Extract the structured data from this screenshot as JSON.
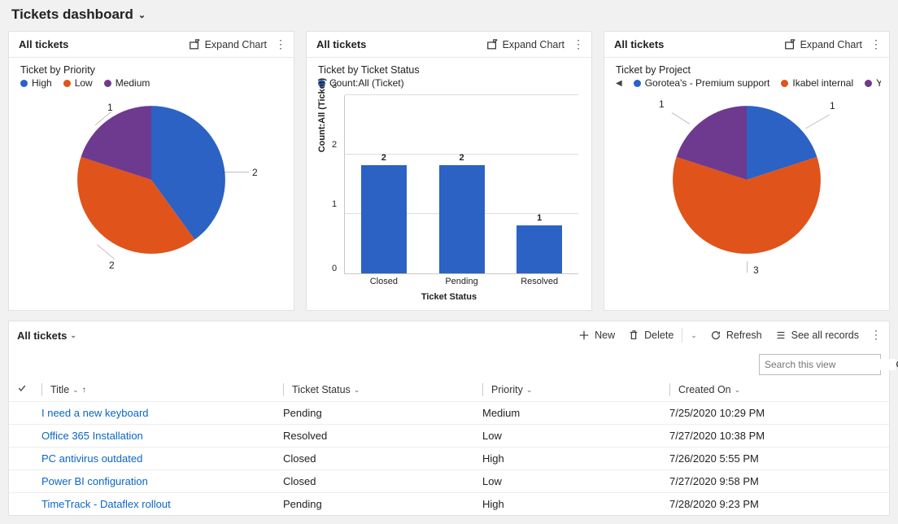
{
  "header": {
    "title": "Tickets dashboard"
  },
  "cards": {
    "priority": {
      "panel_title": "All tickets",
      "expand": "Expand Chart",
      "subtitle": "Ticket by Priority",
      "legend": [
        "High",
        "Low",
        "Medium"
      ]
    },
    "status": {
      "panel_title": "All tickets",
      "expand": "Expand Chart",
      "subtitle": "Ticket by Ticket Status",
      "legend": [
        "Count:All (Ticket)"
      ],
      "xlabel": "Ticket Status",
      "ylabel": "Count:All (Ticket)"
    },
    "project": {
      "panel_title": "All tickets",
      "expand": "Expand Chart",
      "subtitle": "Ticket by Project",
      "legend": [
        "Gorotea's - Premium support",
        "Ikabel internal",
        "Yennu Enterprises Supp…"
      ]
    }
  },
  "grid": {
    "title": "All tickets",
    "toolbar": {
      "new": "New",
      "delete": "Delete",
      "refresh": "Refresh",
      "see_all": "See all records"
    },
    "search_placeholder": "Search this view",
    "columns": {
      "title": "Title",
      "status": "Ticket Status",
      "priority": "Priority",
      "created": "Created On"
    },
    "rows": [
      {
        "title": "I need a new keyboard",
        "status": "Pending",
        "priority": "Medium",
        "created": "7/25/2020 10:29 PM"
      },
      {
        "title": "Office 365 Installation",
        "status": "Resolved",
        "priority": "Low",
        "created": "7/27/2020 10:38 PM"
      },
      {
        "title": "PC antivirus outdated",
        "status": "Closed",
        "priority": "High",
        "created": "7/26/2020 5:55 PM"
      },
      {
        "title": "Power BI configuration",
        "status": "Closed",
        "priority": "Low",
        "created": "7/27/2020 9:58 PM"
      },
      {
        "title": "TimeTrack - Dataflex rollout",
        "status": "Pending",
        "priority": "High",
        "created": "7/28/2020 9:23 PM"
      }
    ]
  },
  "colors": {
    "blue": "#2b62c4",
    "orange": "#e0531a",
    "purple": "#6e3a90"
  },
  "chart_data": [
    {
      "type": "pie",
      "title": "Ticket by Priority",
      "series_name": "Count:All (Ticket)",
      "categories": [
        "High",
        "Low",
        "Medium"
      ],
      "values": [
        2,
        2,
        1
      ],
      "colors": [
        "#2b62c4",
        "#e0531a",
        "#6e3a90"
      ]
    },
    {
      "type": "bar",
      "title": "Ticket by Ticket Status",
      "series_name": "Count:All (Ticket)",
      "categories": [
        "Closed",
        "Pending",
        "Resolved"
      ],
      "values": [
        2,
        2,
        1
      ],
      "xlabel": "Ticket Status",
      "ylabel": "Count:All (Ticket)",
      "ylim": [
        0,
        3
      ],
      "yticks": [
        0,
        1,
        2,
        3
      ]
    },
    {
      "type": "pie",
      "title": "Ticket by Project",
      "series_name": "Count:All (Ticket)",
      "categories": [
        "Gorotea's - Premium support",
        "Ikabel internal",
        "Yennu Enterprises Support"
      ],
      "values": [
        1,
        3,
        1
      ],
      "colors": [
        "#2b62c4",
        "#e0531a",
        "#6e3a90"
      ]
    }
  ]
}
